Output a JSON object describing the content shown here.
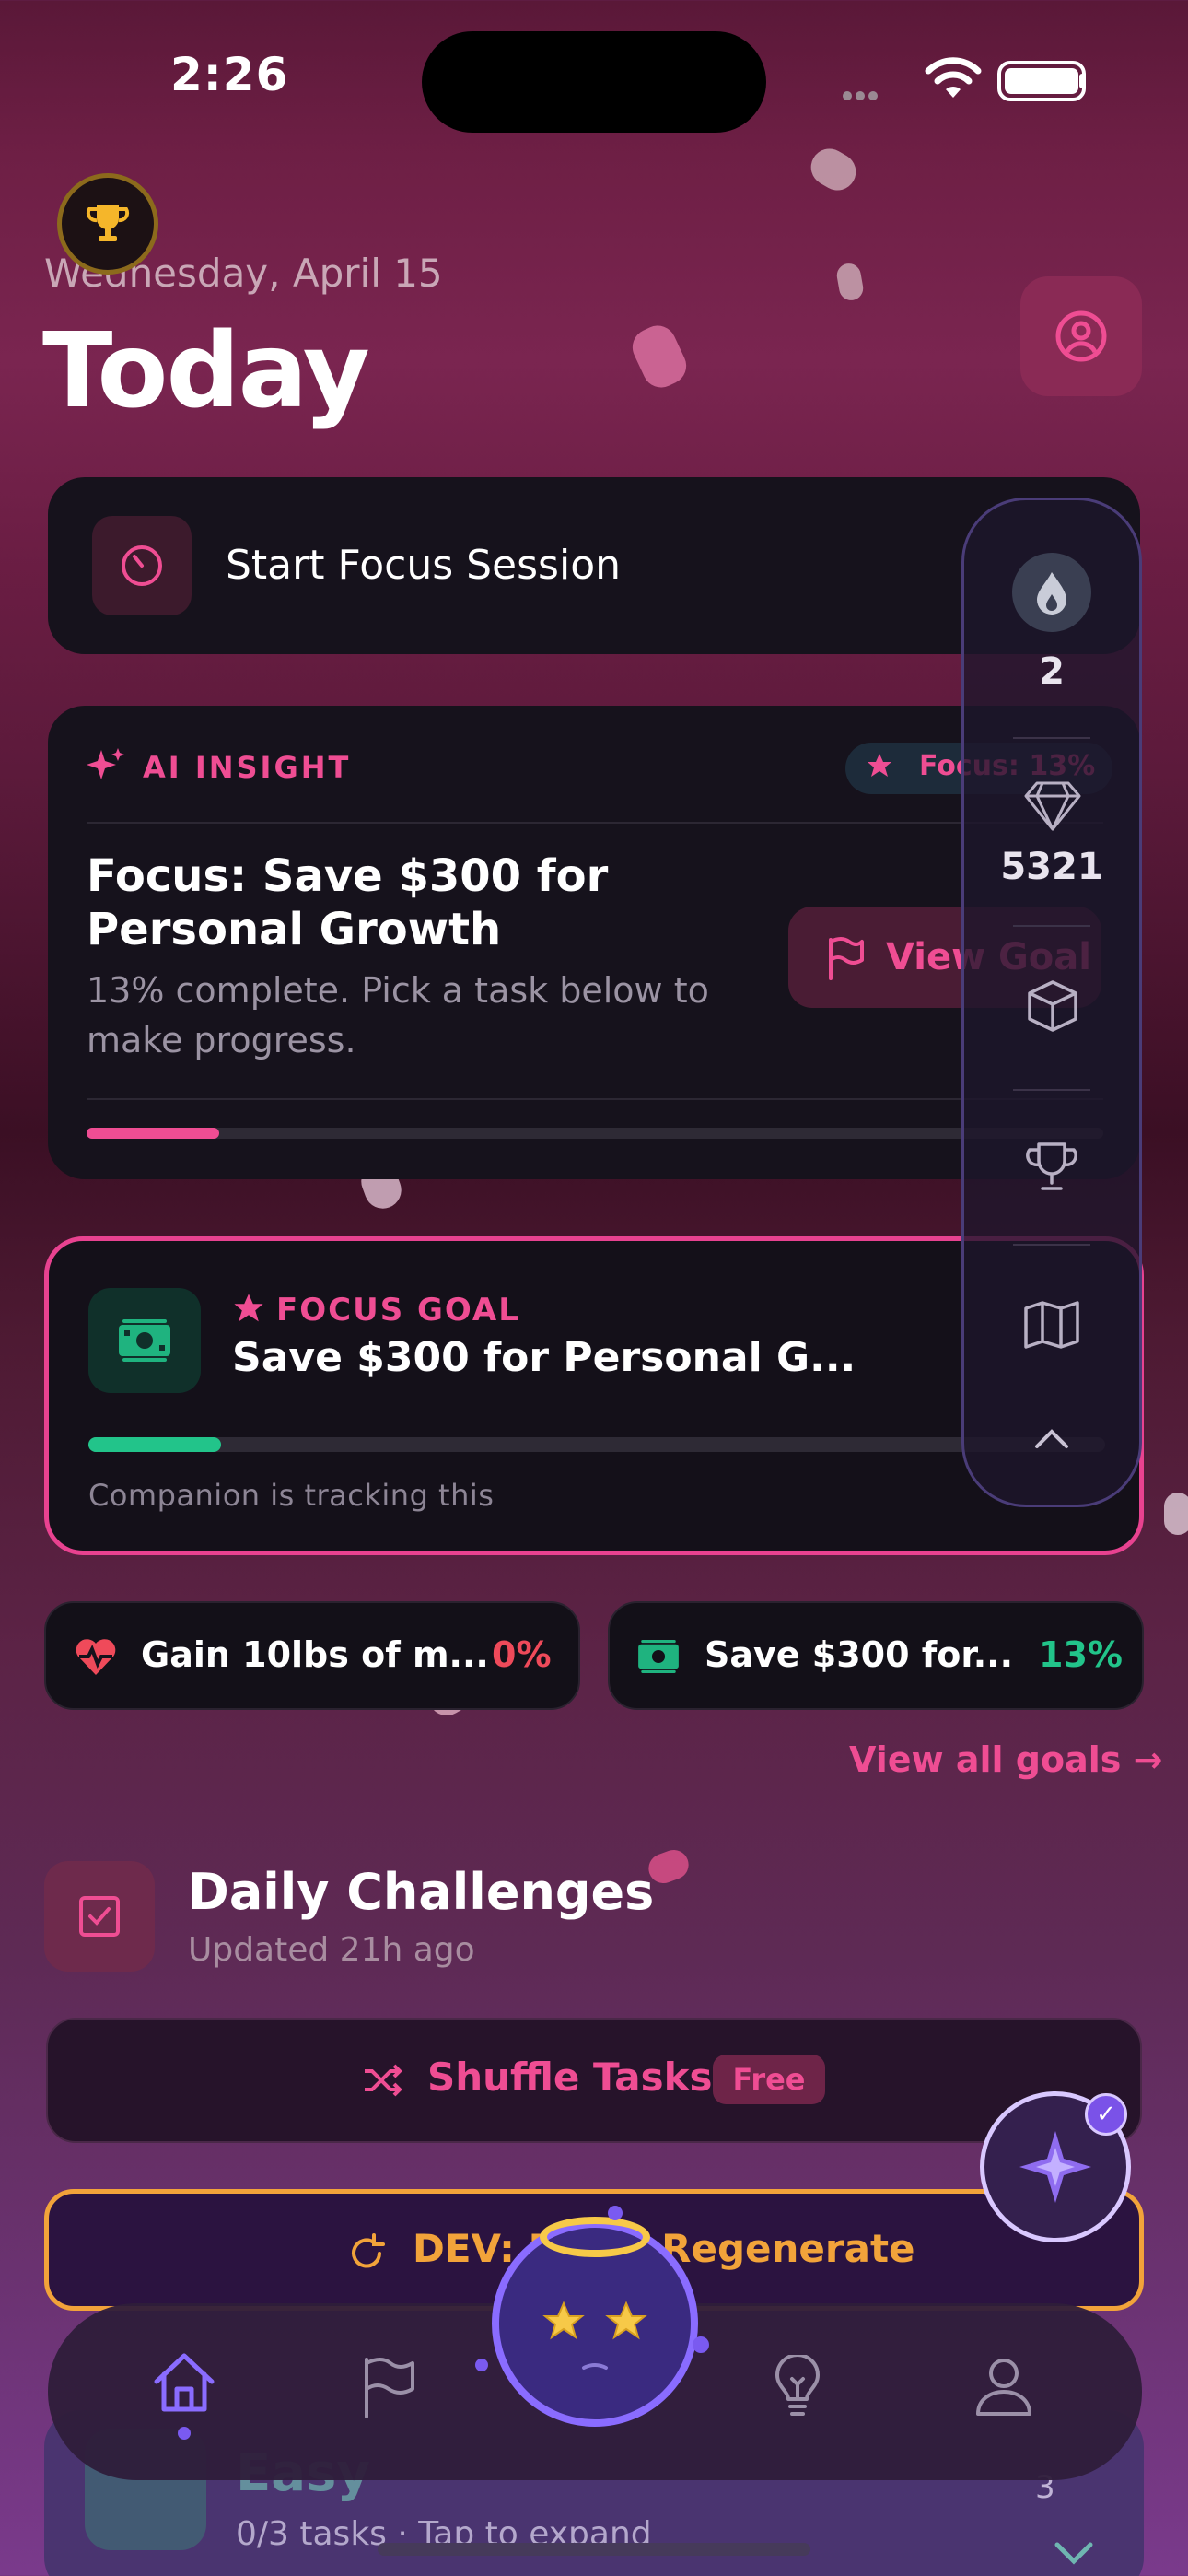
{
  "status_bar": {
    "time": "2:26"
  },
  "header": {
    "date": "Wednesday, April 15",
    "title": "Today"
  },
  "focus_session": {
    "label": "Start Focus Session"
  },
  "ai_insight": {
    "label": "AI INSIGHT",
    "chip": "Focus: 13%",
    "title": "Focus: Save $300 for Personal Growth",
    "subtitle": "13% complete. Pick a task below to make progress.",
    "action": "View Goal",
    "progress": 0.13
  },
  "focus_goal": {
    "label": "FOCUS GOAL",
    "title": "Save $300 for Personal G...",
    "progress": 0.13,
    "subtitle": "Companion is tracking this"
  },
  "goals": [
    {
      "title": "Gain 10lbs of m...",
      "percent": "0%",
      "color": "#ef4a5a",
      "icon": "heart-pulse-icon"
    },
    {
      "title": "Save $300 for...",
      "percent": "13%",
      "color": "#22c48a",
      "icon": "money-icon"
    }
  ],
  "view_all": "View all goals →",
  "daily_challenges": {
    "title": "Daily Challenges",
    "subtitle": "Updated 21h ago",
    "shuffle_label": "Shuffle Tasks",
    "shuffle_badge": "Free",
    "dev_label": "DEV: Force Regenerate"
  },
  "easy_section": {
    "title": "Easy",
    "subtitle": "0/3 tasks · Tap to expand",
    "count": "3"
  },
  "rail": {
    "streak": "2",
    "gems": "5321"
  },
  "colors": {
    "accent": "#ef4d93",
    "success": "#22c48a",
    "warning": "#f2a33a",
    "purple": "#7a5af0"
  }
}
